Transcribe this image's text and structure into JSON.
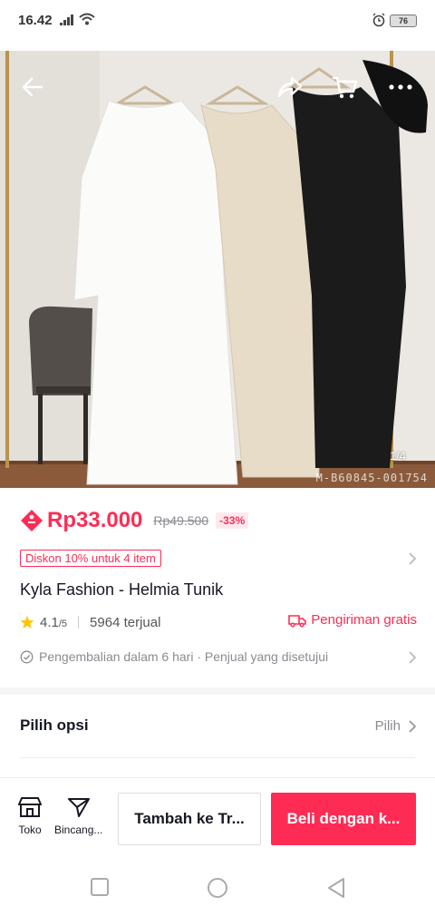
{
  "status_bar": {
    "time": "16.42",
    "battery": "76"
  },
  "gallery": {
    "counter": "1/4",
    "watermark": "M-B60845-001754",
    "colors": [
      "#ffffff",
      "#e6dcc8",
      "#1b1b1b"
    ]
  },
  "price": {
    "current": "Rp33.000",
    "original": "Rp49.500",
    "discount": "-33%"
  },
  "promo": {
    "tag": "Diskon 10% untuk 4 item"
  },
  "product": {
    "title": "Kyla Fashion - Helmia Tunik",
    "rating": "4.1",
    "rating_max": "/5",
    "sold": "5964 terjual",
    "shipping": "Pengiriman gratis",
    "returns": "Pengembalian dalam 6 hari · Penjual yang disetujui"
  },
  "options": {
    "title": "Pilih opsi",
    "action": "Pilih"
  },
  "bottom_bar": {
    "shop_label": "Toko",
    "chat_label": "Bincang...",
    "add_to_cart": "Tambah ke Tr...",
    "buy": "Beli dengan k..."
  },
  "theme": {
    "accent": "#fe2c55",
    "text": "#161823",
    "muted": "#8a8b91",
    "rating_star": "#ffc300"
  }
}
